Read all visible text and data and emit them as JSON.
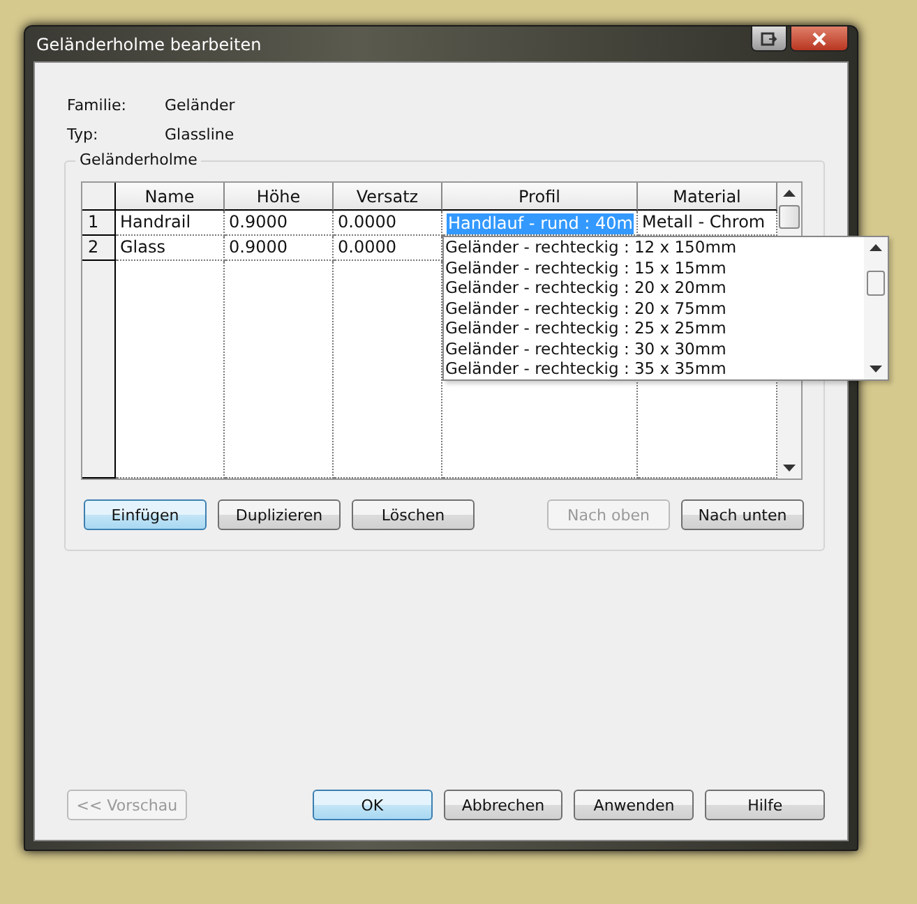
{
  "window": {
    "title": "Geländerholme bearbeiten"
  },
  "info": [
    {
      "label": "Familie:",
      "value": "Geländer"
    },
    {
      "label": "Typ:",
      "value": "Glassline"
    }
  ],
  "group": {
    "title": "Geländerholme"
  },
  "table": {
    "columns": [
      "Name",
      "Höhe",
      "Versatz",
      "Profil",
      "Material"
    ],
    "rows": [
      {
        "index": "1",
        "cells": [
          {
            "text": "Handrail",
            "editing": false
          },
          {
            "text": "0.9000",
            "editing": false
          },
          {
            "text": "0.0000",
            "editing": false
          },
          {
            "text": "Handlauf - rund : 40m",
            "editing": true
          },
          {
            "text": "Metall - Chrom",
            "editing": false
          }
        ]
      },
      {
        "index": "2",
        "cells": [
          {
            "text": "Glass",
            "editing": false
          },
          {
            "text": "0.9000",
            "editing": false
          },
          {
            "text": "0.0000",
            "editing": false
          }
        ]
      }
    ]
  },
  "dropdown": {
    "options": [
      "Geländer - rechteckig : 12 x 150mm",
      "Geländer - rechteckig : 15 x 15mm",
      "Geländer - rechteckig : 20 x 20mm",
      "Geländer - rechteckig : 20 x 75mm",
      "Geländer - rechteckig : 25 x 25mm",
      "Geländer - rechteckig : 30 x 30mm",
      "Geländer - rechteckig : 35 x 35mm"
    ]
  },
  "table_buttons": [
    {
      "label": "Einfügen",
      "default": true,
      "disabled": false
    },
    {
      "label": "Duplizieren",
      "default": false,
      "disabled": false
    },
    {
      "label": "Löschen",
      "default": false,
      "disabled": false
    },
    {
      "label": "Nach oben",
      "default": false,
      "disabled": true
    },
    {
      "label": "Nach unten",
      "default": false,
      "disabled": false
    }
  ],
  "dialog_buttons": [
    {
      "label": "<< Vorschau",
      "default": false,
      "disabled": true
    },
    {
      "label": "OK",
      "default": true,
      "disabled": false
    },
    {
      "label": "Abbrechen",
      "default": false,
      "disabled": false
    },
    {
      "label": "Anwenden",
      "default": false,
      "disabled": false
    },
    {
      "label": "Hilfe",
      "default": false,
      "disabled": false
    }
  ]
}
